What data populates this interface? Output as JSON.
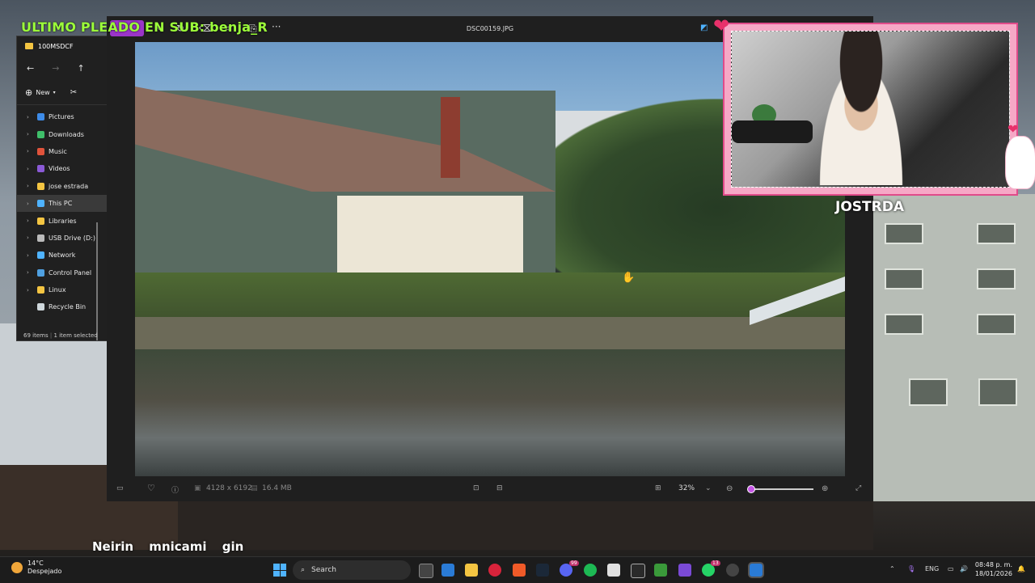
{
  "overlay": {
    "top_text": "ULTIMO PLEADO EN SUB: benja_R",
    "subtitle": "Neirin mnicami gin"
  },
  "explorer": {
    "title": "100MSDCF",
    "new_label": "New",
    "items": [
      {
        "label": "Pictures",
        "icon": "pictures-icon",
        "color": "#3d8be8"
      },
      {
        "label": "Downloads",
        "icon": "downloads-icon",
        "color": "#3fbf6a"
      },
      {
        "label": "Music",
        "icon": "music-icon",
        "color": "#e0533b"
      },
      {
        "label": "Videos",
        "icon": "videos-icon",
        "color": "#8b5ad6"
      },
      {
        "label": "jose estrada",
        "icon": "folder-icon",
        "color": "#f4c542"
      },
      {
        "label": "This PC",
        "icon": "this-pc-icon",
        "color": "#4fb3ff",
        "selected": true
      },
      {
        "label": "Libraries",
        "icon": "folder-icon",
        "color": "#f4c542"
      },
      {
        "label": "USB Drive (D:)",
        "icon": "usb-drive-icon",
        "color": "#bbbbbb"
      },
      {
        "label": "Network",
        "icon": "network-icon",
        "color": "#4fb3ff"
      },
      {
        "label": "Control Panel",
        "icon": "control-panel-icon",
        "color": "#4fa0e0"
      },
      {
        "label": "Linux",
        "icon": "linux-icon",
        "color": "#f4c542"
      },
      {
        "label": "Recycle Bin",
        "icon": "recycle-bin-icon",
        "color": "#cfd8dc"
      }
    ],
    "status_items": "69 items",
    "status_selected": "1 item selected"
  },
  "viewer": {
    "filename": "DSC00159.JPG",
    "dimensions": "4128 x 6192",
    "filesize": "16.4 MB",
    "zoom": "32%",
    "zoom_fraction": 0.0
  },
  "webcam": {
    "name": "JOSTRDA"
  },
  "taskbar": {
    "temperature": "14°C",
    "condition": "Despejado",
    "search_label": "Search",
    "language": "ENG",
    "time": "08:48 p. m.",
    "date": "18/01/2026",
    "badge_discord": "99",
    "badge_whatsapp": "13"
  }
}
